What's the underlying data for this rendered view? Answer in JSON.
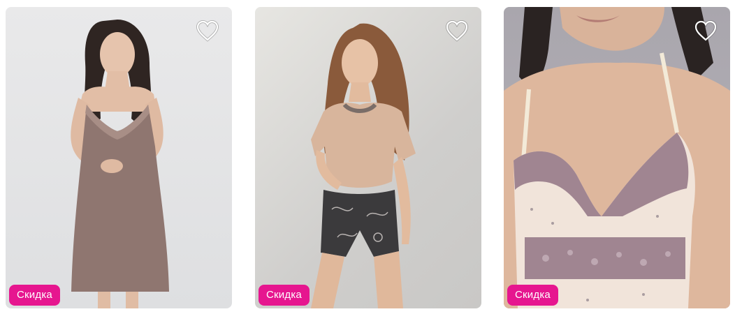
{
  "products": [
    {
      "badge_label": "Скидка",
      "favorite_icon": "heart-outline-icon",
      "colors": {
        "garment": "#8f7670",
        "background": "#e4e4e6"
      }
    },
    {
      "badge_label": "Скидка",
      "favorite_icon": "heart-outline-icon",
      "colors": {
        "garment": "#d8b59c",
        "background": "#d9d8d5"
      }
    },
    {
      "badge_label": "Скидка",
      "favorite_icon": "heart-outline-icon",
      "colors": {
        "garment": "#a08591",
        "background": "#b0adb3"
      }
    }
  ],
  "theme": {
    "badge_color": "#e6168f",
    "badge_text_color": "#ffffff"
  }
}
